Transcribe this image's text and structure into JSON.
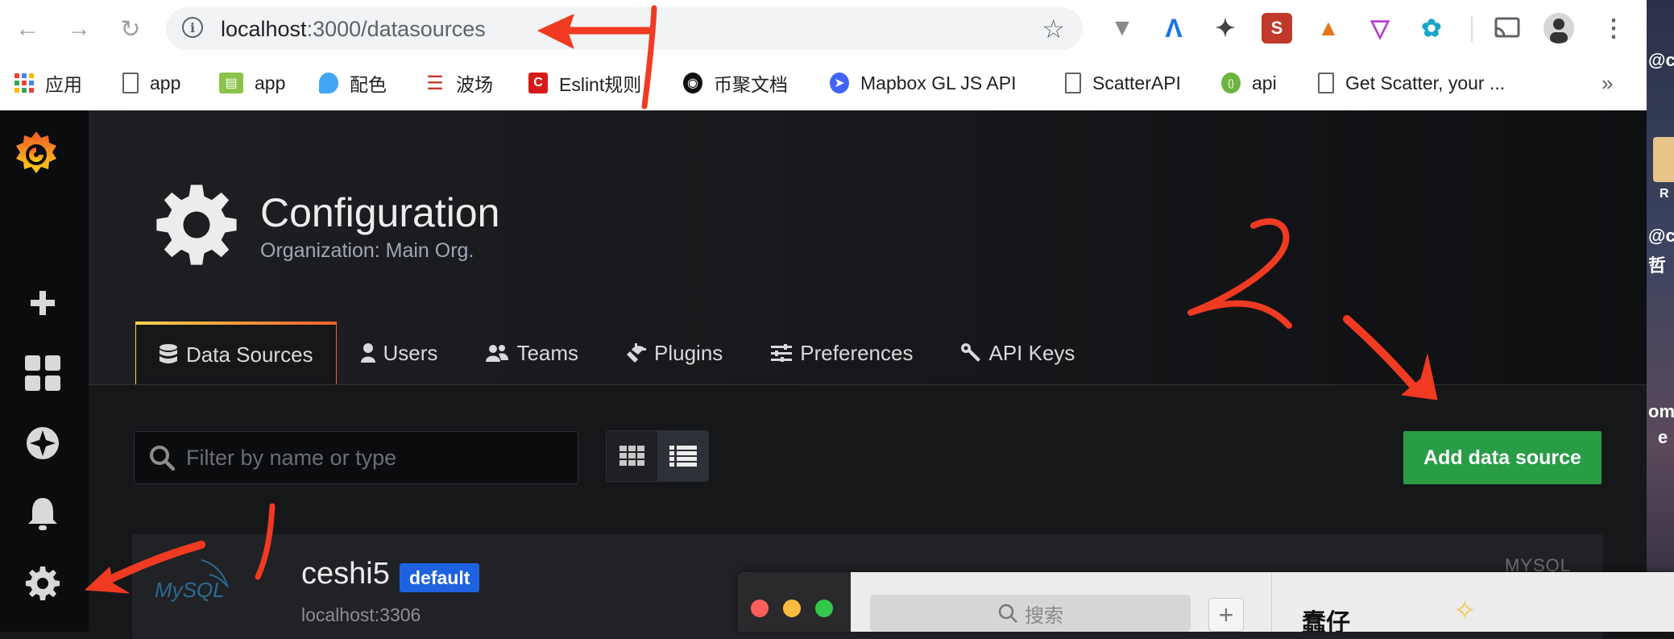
{
  "browser": {
    "url_host": "localhost",
    "url_rest": ":3000/datasources",
    "bookmarks": [
      {
        "label": "应用"
      },
      {
        "label": "app"
      },
      {
        "label": "app"
      },
      {
        "label": "配色"
      },
      {
        "label": "波场"
      },
      {
        "label": "Eslint规则"
      },
      {
        "label": "币聚文档"
      },
      {
        "label": "Mapbox GL JS API"
      },
      {
        "label": "ScatterAPI"
      },
      {
        "label": "api"
      },
      {
        "label": "Get Scatter, your ..."
      }
    ],
    "more_label": "»"
  },
  "sidebar": {
    "items": [
      "create-icon",
      "dashboards-icon",
      "explore-icon",
      "alerting-icon",
      "configuration-icon"
    ]
  },
  "page": {
    "title": "Configuration",
    "subtitle": "Organization: Main Org."
  },
  "tabs": [
    {
      "label": "Data Sources",
      "active": true
    },
    {
      "label": "Users"
    },
    {
      "label": "Teams"
    },
    {
      "label": "Plugins"
    },
    {
      "label": "Preferences"
    },
    {
      "label": "API Keys"
    }
  ],
  "toolbar": {
    "filter_placeholder": "Filter by name or type",
    "add_label": "Add data source"
  },
  "datasources": [
    {
      "name": "ceshi5",
      "badge": "default",
      "url": "localhost:3306",
      "type": "MYSQL",
      "logo_text": "MySQL"
    }
  ],
  "overlay_window": {
    "search_placeholder": "搜索",
    "plus": "+",
    "chat_title": "蠢仔"
  },
  "desktop_strip": {
    "fragments": [
      "@co",
      "R",
      "@co",
      "哲",
      "ome",
      "e"
    ]
  },
  "annotations": [
    "1",
    "2"
  ],
  "colors": {
    "accent_green": "#299c46",
    "badge_blue": "#1f62e0",
    "annotation_red": "#f03a22",
    "grafana_orange": "#f47a20"
  }
}
